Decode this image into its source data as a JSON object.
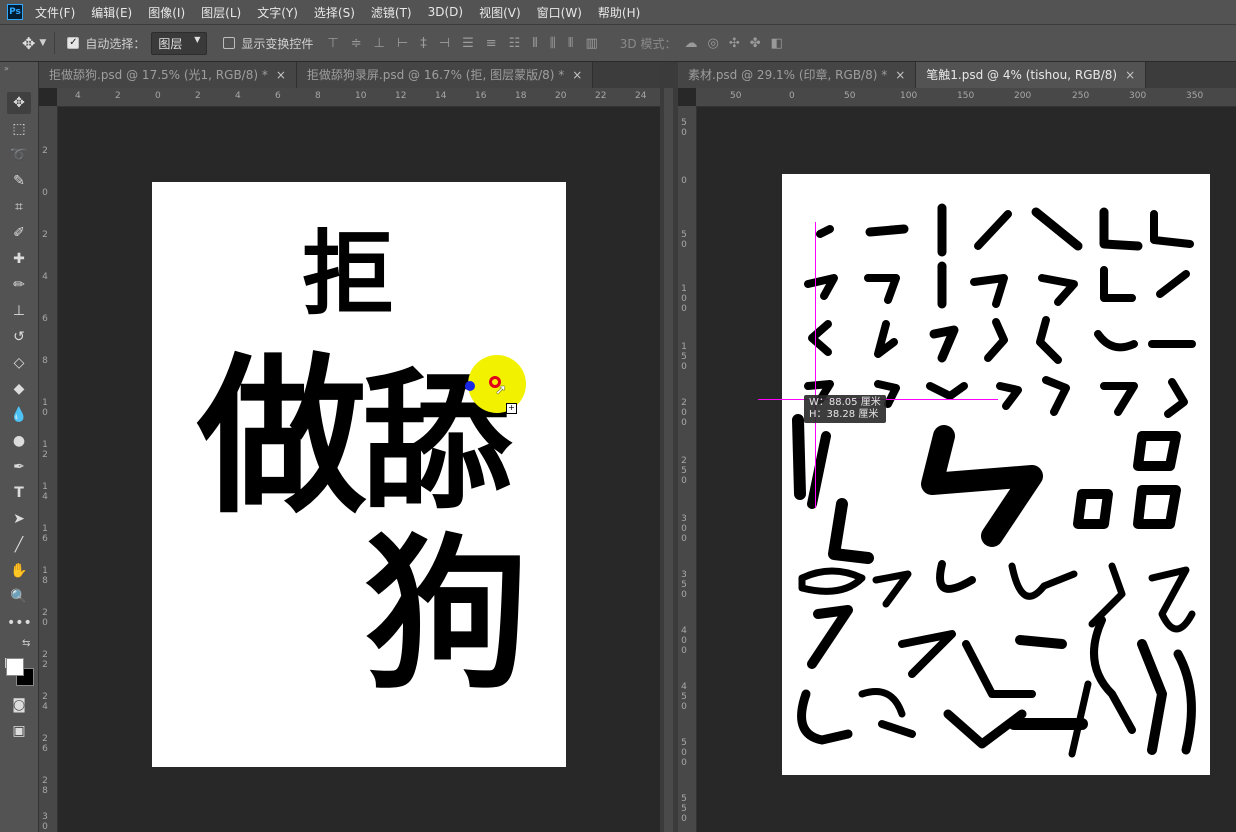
{
  "app": {
    "logo": "Ps"
  },
  "menu": [
    "文件(F)",
    "编辑(E)",
    "图像(I)",
    "图层(L)",
    "文字(Y)",
    "选择(S)",
    "滤镜(T)",
    "3D(D)",
    "视图(V)",
    "窗口(W)",
    "帮助(H)"
  ],
  "options": {
    "auto_select_label": "自动选择：",
    "auto_select_value": "图层",
    "show_transform_label": "显示变换控件",
    "mode_3d_label": "3D 模式："
  },
  "left_doc": {
    "tabs": [
      {
        "label": "拒做舔狗.psd @ 17.5% (光1, RGB/8) *",
        "close": "×"
      },
      {
        "label": "拒做舔狗录屏.psd @ 16.7% (拒, 图层蒙版/8) *",
        "close": "×"
      }
    ],
    "ruler_h": [
      "4",
      "2",
      "0",
      "2",
      "4",
      "6",
      "8",
      "10",
      "12",
      "14",
      "16",
      "18",
      "20",
      "22",
      "24"
    ],
    "ruler_v": [
      "2",
      "0",
      "2",
      "4",
      "6",
      "8",
      "10",
      "12",
      "14",
      "16",
      "18",
      "20",
      "22",
      "24",
      "26",
      "28",
      "30"
    ],
    "calligraphy": [
      "拒",
      "做",
      "舔",
      "狗"
    ]
  },
  "right_doc": {
    "tabs": [
      {
        "label": "素材.psd @ 29.1% (印章, RGB/8) *",
        "close": "×"
      },
      {
        "label": "笔触1.psd @ 4% (tishou, RGB/8)",
        "close": "×"
      }
    ],
    "ruler_h": [
      "50",
      "0",
      "50",
      "100",
      "150",
      "200",
      "250",
      "300",
      "350"
    ],
    "ruler_v": [
      "50",
      "0",
      "50",
      "100",
      "150",
      "200",
      "250",
      "300",
      "350",
      "400",
      "450",
      "500",
      "550"
    ],
    "tooltip_w": "88.05 厘米",
    "tooltip_h": "38.28 厘米",
    "tooltip_w_label": "W：",
    "tooltip_h_label": "H："
  },
  "colors": {
    "guide": "#ff00ff",
    "highlight": "#f2f200",
    "target": "#e0001a",
    "anchor": "#1a28e6"
  },
  "icons": [
    "move-icon",
    "marquee-icon",
    "lasso-icon",
    "quick-select-icon",
    "crop-icon",
    "eyedropper-icon",
    "healing-icon",
    "brush-icon",
    "stamp-icon",
    "history-brush-icon",
    "eraser-icon",
    "bucket-icon",
    "blur-icon",
    "dodge-icon",
    "pen-icon",
    "type-icon",
    "path-select-icon",
    "line-icon",
    "hand-icon",
    "zoom-icon",
    "more-icon",
    "quick-mask-icon",
    "screen-mode-icon"
  ]
}
